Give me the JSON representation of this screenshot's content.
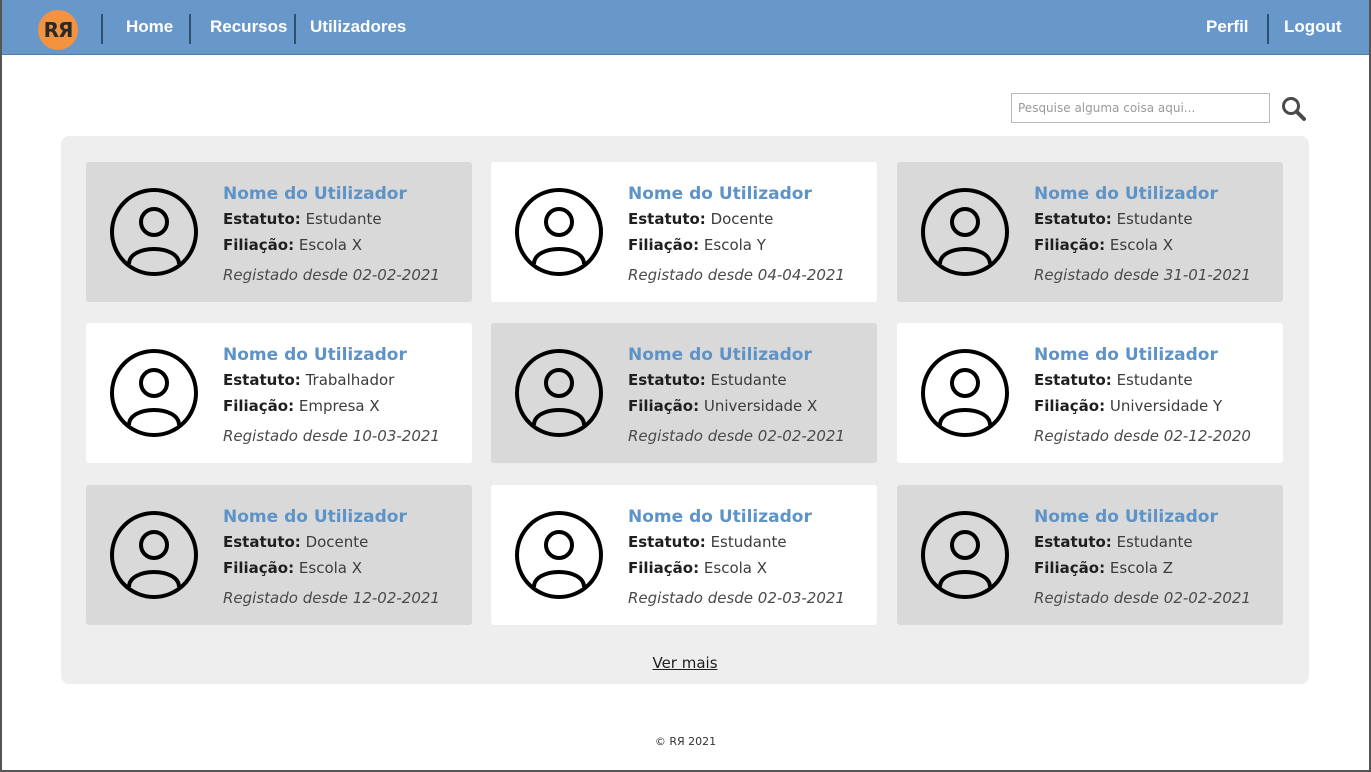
{
  "nav": {
    "logo_text": "RЯ",
    "home": "Home",
    "recursos": "Recursos",
    "utilizadores": "Utilizadores",
    "perfil": "Perfil",
    "logout": "Logout"
  },
  "search": {
    "placeholder": "Pesquise alguma coisa aqui...",
    "icon": "search-icon"
  },
  "labels": {
    "estatuto": "Estatuto:",
    "filiacao": "Filiação:"
  },
  "users": [
    {
      "name": "Nome do Utilizador",
      "estatuto": "Estudante",
      "filiacao": "Escola X",
      "registered": "Registado desde 02-02-2021"
    },
    {
      "name": "Nome do Utilizador",
      "estatuto": "Docente",
      "filiacao": "Escola Y",
      "registered": "Registado desde 04-04-2021"
    },
    {
      "name": "Nome do Utilizador",
      "estatuto": "Estudante",
      "filiacao": "Escola X",
      "registered": "Registado desde 31-01-2021"
    },
    {
      "name": "Nome do Utilizador",
      "estatuto": "Trabalhador",
      "filiacao": "Empresa X",
      "registered": "Registado desde 10-03-2021"
    },
    {
      "name": "Nome do Utilizador",
      "estatuto": "Estudante",
      "filiacao": "Universidade X",
      "registered": "Registado desde 02-02-2021"
    },
    {
      "name": "Nome do Utilizador",
      "estatuto": "Estudante",
      "filiacao": "Universidade Y",
      "registered": "Registado desde 02-12-2020"
    },
    {
      "name": "Nome do Utilizador",
      "estatuto": "Docente",
      "filiacao": "Escola X",
      "registered": "Registado desde 12-02-2021"
    },
    {
      "name": "Nome do Utilizador",
      "estatuto": "Estudante",
      "filiacao": "Escola X",
      "registered": "Registado desde 02-03-2021"
    },
    {
      "name": "Nome do Utilizador",
      "estatuto": "Estudante",
      "filiacao": "Escola Z",
      "registered": "Registado desde 02-02-2021"
    }
  ],
  "ver_mais": "Ver mais",
  "footer": "© RЯ 2021",
  "colors": {
    "navbar": "#6898c9",
    "logo": "#f4933f",
    "name_link": "#5e93c8",
    "card_grey": "#d9d9d9",
    "panel": "#eeeeee"
  }
}
